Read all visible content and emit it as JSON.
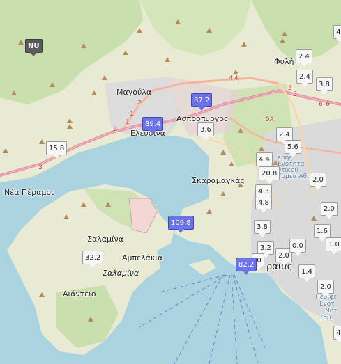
{
  "places": {
    "nea_peramos": "Νέα Πέραμος",
    "magoula": "Μαγούλα",
    "elefsina": "Ελευσίνα",
    "aspropyrgos": "Ασπρόπυργος",
    "skaramangas": "Σκαραμαγκάς",
    "fyli": "Φυλή",
    "salamina": "Σαλαμίνα",
    "salamina_island": "Σαλαμίνα",
    "ampelakia": "Αμπελάκια",
    "aianteio": "Αιάντειο",
    "peiraias": "ραιάς",
    "dytiko_1": "ερής",
    "dytiko_2": "Ενότητα",
    "dytiko_3": "υτικού",
    "dytiko_4": "Τομέα Αθηνών",
    "south_1": "Περιφε",
    "south_2": "Ενότ",
    "south_3": "Νοτ",
    "south_4": "Τομ"
  },
  "roads": [
    "2",
    "1",
    "1",
    "2",
    "3",
    "4",
    "4",
    "5",
    "5",
    "5A",
    "6",
    "6"
  ],
  "markers": [
    {
      "id": "nu",
      "label": "NU",
      "style": "dark"
    },
    {
      "id": "m1",
      "label": "15.8",
      "style": "normal"
    },
    {
      "id": "m2",
      "label": "89.4",
      "style": "hi"
    },
    {
      "id": "m3",
      "label": "87.2",
      "style": "hi"
    },
    {
      "id": "m4",
      "label": "3.6",
      "style": "normal"
    },
    {
      "id": "m5",
      "label": "2.4",
      "style": "normal"
    },
    {
      "id": "m6",
      "label": "2.4",
      "style": "normal"
    },
    {
      "id": "m7",
      "label": "3.8",
      "style": "normal"
    },
    {
      "id": "m8",
      "label": "4.",
      "style": "normal"
    },
    {
      "id": "m9",
      "label": "2.4",
      "style": "normal"
    },
    {
      "id": "m10",
      "label": "5.6",
      "style": "normal"
    },
    {
      "id": "m11",
      "label": "4.4",
      "style": "normal"
    },
    {
      "id": "m12",
      "label": "20.8",
      "style": "normal"
    },
    {
      "id": "m13",
      "label": "2.0",
      "style": "normal"
    },
    {
      "id": "m14",
      "label": "4.3",
      "style": "normal"
    },
    {
      "id": "m15",
      "label": "4.8",
      "style": "normal"
    },
    {
      "id": "m16",
      "label": "2.0",
      "style": "normal"
    },
    {
      "id": "m17",
      "label": "109.8",
      "style": "hi"
    },
    {
      "id": "m18",
      "label": "3.8",
      "style": "normal"
    },
    {
      "id": "m19",
      "label": "1.6",
      "style": "normal"
    },
    {
      "id": "m20",
      "label": "1.0",
      "style": "normal"
    },
    {
      "id": "m21",
      "label": "32.2",
      "style": "normal"
    },
    {
      "id": "m22",
      "label": "3.2",
      "style": "normal"
    },
    {
      "id": "m23",
      "label": "2.0",
      "style": "normal"
    },
    {
      "id": "m24",
      "label": "0.0",
      "style": "normal"
    },
    {
      "id": "m25",
      "label": ".0",
      "style": "normal"
    },
    {
      "id": "m26",
      "label": "82.2",
      "style": "hi"
    },
    {
      "id": "m27",
      "label": "1.4",
      "style": "normal"
    },
    {
      "id": "m28",
      "label": "2.0",
      "style": "normal"
    },
    {
      "id": "m29",
      "label": "4.",
      "style": "normal"
    }
  ]
}
